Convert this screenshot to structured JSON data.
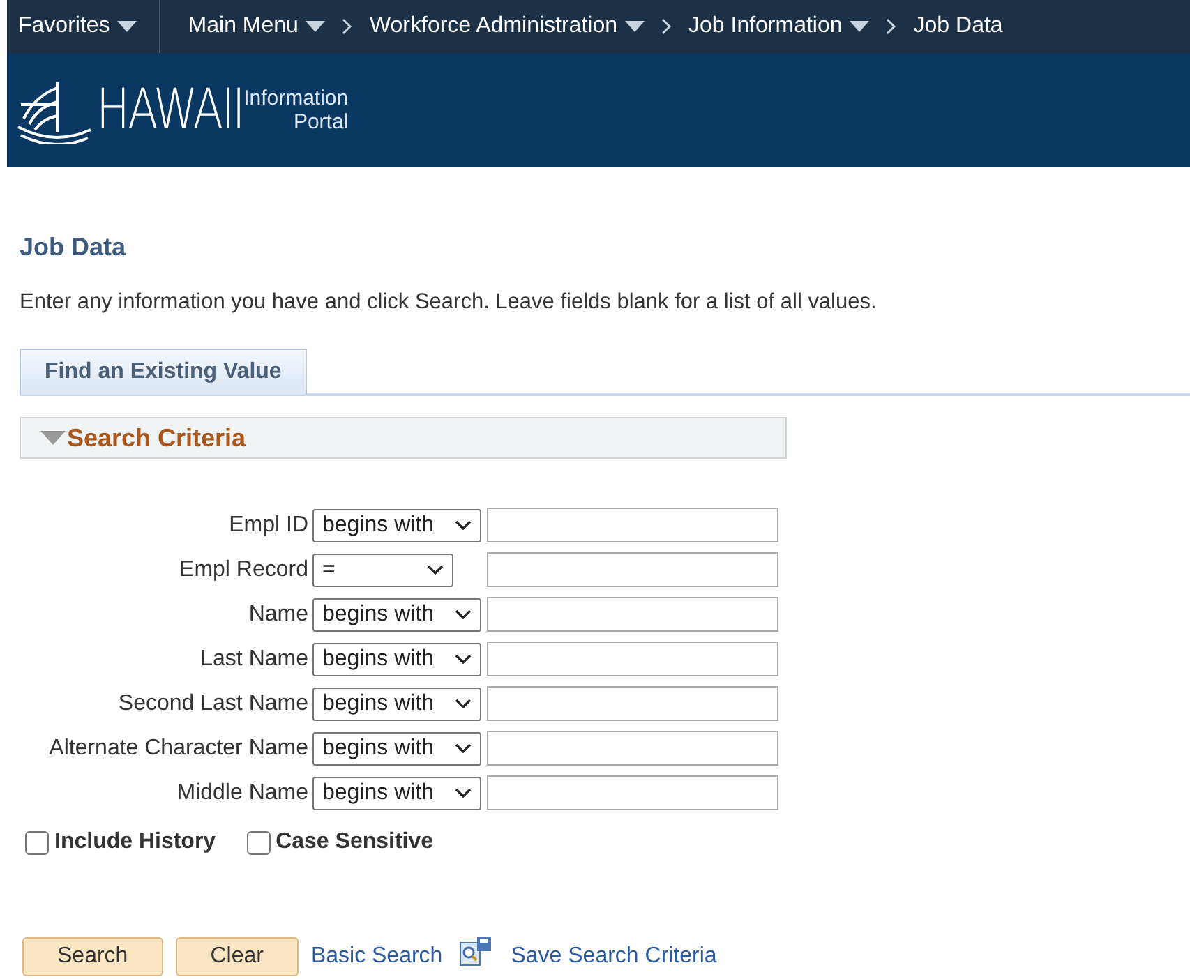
{
  "nav": {
    "items": [
      {
        "label": "Favorites",
        "kind": "menu"
      },
      {
        "label": "Main Menu",
        "kind": "menu"
      },
      {
        "label": "Workforce Administration",
        "kind": "crumb_menu"
      },
      {
        "label": "Job Information",
        "kind": "crumb_menu"
      },
      {
        "label": "Job Data",
        "kind": "crumb"
      }
    ]
  },
  "banner": {
    "logo_main": "HAWAII",
    "logo_sub_1": "Information",
    "logo_sub_2": "Portal"
  },
  "page": {
    "title": "Job Data",
    "instructions": "Enter any information you have and click Search. Leave fields blank for a list of all values."
  },
  "tabs": [
    {
      "label": "Find an Existing Value",
      "selected": true
    }
  ],
  "section": {
    "title": "Search Criteria",
    "expanded": true
  },
  "fields": [
    {
      "label": "Empl ID",
      "operator": "begins with",
      "kind": "wide"
    },
    {
      "label": "Empl Record",
      "operator": "=",
      "kind": "narrow"
    },
    {
      "label": "Name",
      "operator": "begins with",
      "kind": "wide"
    },
    {
      "label": "Last Name",
      "operator": "begins with",
      "kind": "wide"
    },
    {
      "label": "Second Last Name",
      "operator": "begins with",
      "kind": "wide"
    },
    {
      "label": "Alternate Character Name",
      "operator": "begins with",
      "kind": "wide"
    },
    {
      "label": "Middle Name",
      "operator": "begins with",
      "kind": "wide"
    }
  ],
  "checkboxes": [
    {
      "label": "Include History",
      "checked": false
    },
    {
      "label": "Case Sensitive",
      "checked": false
    }
  ],
  "actions": [
    {
      "label": "Search",
      "kind": "button"
    },
    {
      "label": "Clear",
      "kind": "button"
    },
    {
      "label": "Basic Search",
      "kind": "link"
    },
    {
      "label": "Save Search Criteria",
      "kind": "icon_link"
    }
  ]
}
